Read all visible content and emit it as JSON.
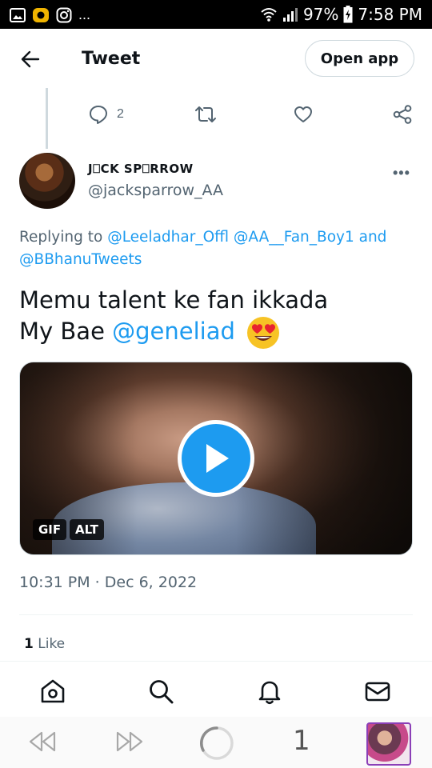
{
  "status_bar": {
    "battery": "97%",
    "time": "7:58 PM",
    "more": "..."
  },
  "header": {
    "title": "Tweet",
    "open_app_label": "Open app"
  },
  "parent_actions": {
    "reply_count": "2"
  },
  "tweet": {
    "display_name": "J⎕CK SP⎕RROW",
    "handle": "@jacksparrow_AA",
    "more": "•••",
    "replying_prefix": "Replying to ",
    "mention_1": "@Leeladhar_Offl",
    "mention_2": "@AA__Fan_Boy1",
    "and_word": "and",
    "mention_3": "@BBhanuTweets",
    "text_line1": "Memu talent ke fan ikkada",
    "text_line2_prefix": "My Bae ",
    "text_mention": "@geneliad",
    "gif_badge": "GIF",
    "alt_badge": "ALT",
    "timestamp": "10:31 PM · Dec 6, 2022",
    "like_count": "1",
    "like_label": " Like"
  },
  "browser_bar": {
    "tab_count": "1"
  },
  "colors": {
    "accent": "#1d9bf0",
    "muted": "#536471",
    "text": "#0f1419"
  }
}
